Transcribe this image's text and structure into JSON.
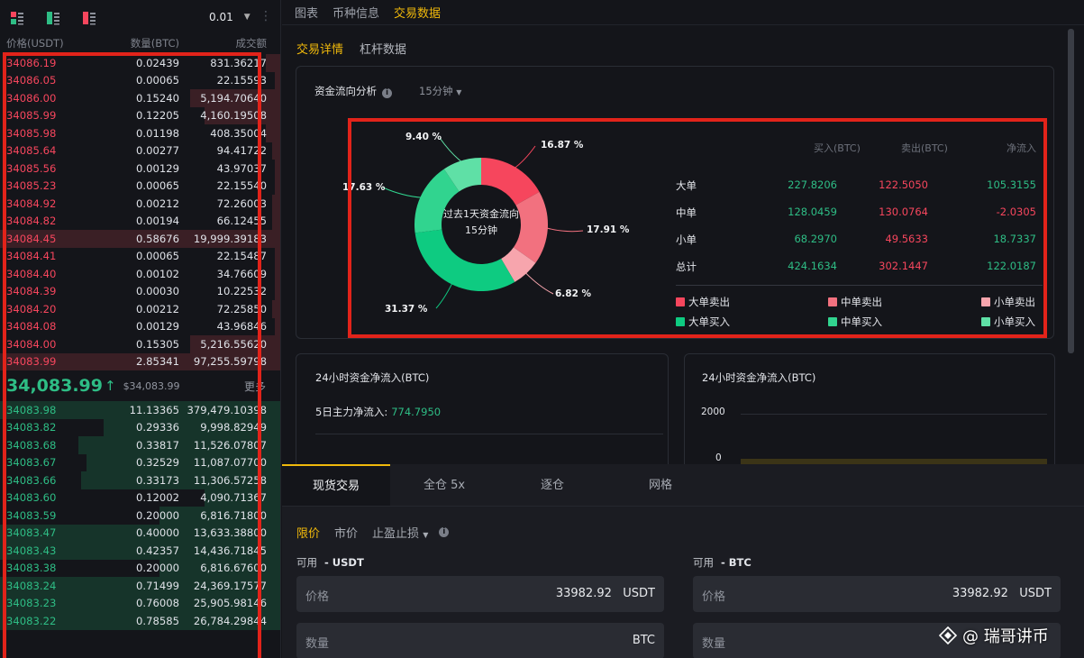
{
  "orderbook": {
    "precision": "0.01",
    "headers": {
      "price": "价格(USDT)",
      "amount": "数量(BTC)",
      "total": "成交额"
    },
    "asks": [
      {
        "price": "34086.19",
        "amount": "0.02439",
        "total": "831.36217",
        "depth": 0.05
      },
      {
        "price": "34086.05",
        "amount": "0.00065",
        "total": "22.15593",
        "depth": 0.02
      },
      {
        "price": "34086.00",
        "amount": "0.15240",
        "total": "5,194.70640",
        "depth": 0.32
      },
      {
        "price": "34085.99",
        "amount": "0.12205",
        "total": "4,160.19508",
        "depth": 0.27
      },
      {
        "price": "34085.98",
        "amount": "0.01198",
        "total": "408.35004",
        "depth": 0.05
      },
      {
        "price": "34085.64",
        "amount": "0.00277",
        "total": "94.41722",
        "depth": 0.03
      },
      {
        "price": "34085.56",
        "amount": "0.00129",
        "total": "43.97037",
        "depth": 0.02
      },
      {
        "price": "34085.23",
        "amount": "0.00065",
        "total": "22.15540",
        "depth": 0.02
      },
      {
        "price": "34084.92",
        "amount": "0.00212",
        "total": "72.26003",
        "depth": 0.03
      },
      {
        "price": "34084.82",
        "amount": "0.00194",
        "total": "66.12455",
        "depth": 0.03
      },
      {
        "price": "34084.45",
        "amount": "0.58676",
        "total": "19,999.39183",
        "depth": 1.0
      },
      {
        "price": "34084.41",
        "amount": "0.00065",
        "total": "22.15487",
        "depth": 0.02
      },
      {
        "price": "34084.40",
        "amount": "0.00102",
        "total": "34.76609",
        "depth": 0.02
      },
      {
        "price": "34084.39",
        "amount": "0.00030",
        "total": "10.22532",
        "depth": 0.02
      },
      {
        "price": "34084.20",
        "amount": "0.00212",
        "total": "72.25850",
        "depth": 0.03
      },
      {
        "price": "34084.08",
        "amount": "0.00129",
        "total": "43.96846",
        "depth": 0.02
      },
      {
        "price": "34084.00",
        "amount": "0.15305",
        "total": "5,216.55620",
        "depth": 0.32
      },
      {
        "price": "34083.99",
        "amount": "2.85341",
        "total": "97,255.59798",
        "depth": 1.0
      }
    ],
    "mid": {
      "price": "34,083.99",
      "arrow": "↑",
      "usd": "$34,083.99",
      "more": "更多"
    },
    "bids": [
      {
        "price": "34083.98",
        "amount": "11.13365",
        "total": "379,479.10398",
        "depth": 1.0
      },
      {
        "price": "34083.82",
        "amount": "0.29336",
        "total": "9,998.82949",
        "depth": 0.63
      },
      {
        "price": "34083.68",
        "amount": "0.33817",
        "total": "11,526.07807",
        "depth": 0.72
      },
      {
        "price": "34083.67",
        "amount": "0.32529",
        "total": "11,087.07700",
        "depth": 0.69
      },
      {
        "price": "34083.66",
        "amount": "0.33173",
        "total": "11,306.57258",
        "depth": 0.71
      },
      {
        "price": "34083.60",
        "amount": "0.12002",
        "total": "4,090.71367",
        "depth": 0.27
      },
      {
        "price": "34083.59",
        "amount": "0.20000",
        "total": "6,816.71800",
        "depth": 0.43
      },
      {
        "price": "34083.47",
        "amount": "0.40000",
        "total": "13,633.38800",
        "depth": 1.0
      },
      {
        "price": "34083.43",
        "amount": "0.42357",
        "total": "14,436.71845",
        "depth": 1.0
      },
      {
        "price": "34083.38",
        "amount": "0.20000",
        "total": "6,816.67600",
        "depth": 0.43
      },
      {
        "price": "34083.24",
        "amount": "0.71499",
        "total": "24,369.17577",
        "depth": 1.0
      },
      {
        "price": "34083.23",
        "amount": "0.76008",
        "total": "25,905.98146",
        "depth": 1.0
      },
      {
        "price": "34083.22",
        "amount": "0.78585",
        "total": "26,784.29844",
        "depth": 1.0
      }
    ]
  },
  "top_tabs": [
    "图表",
    "币种信息",
    "交易数据"
  ],
  "sub_tabs": [
    "交易详情",
    "杠杆数据"
  ],
  "flow": {
    "title": "资金流向分析",
    "interval": "15分钟",
    "center_line1": "过去1天资金流向",
    "center_line2": "15分钟",
    "slices": [
      {
        "label": "16.87 %",
        "value": 16.87,
        "color": "#f6465d"
      },
      {
        "label": "17.91 %",
        "value": 17.91,
        "color": "#f2717f"
      },
      {
        "label": "6.82 %",
        "value": 6.82,
        "color": "#f7a5ad"
      },
      {
        "label": "31.37 %",
        "value": 31.37,
        "color": "#0ecb81"
      },
      {
        "label": "17.63 %",
        "value": 17.63,
        "color": "#31d48f"
      },
      {
        "label": "9.40 %",
        "value": 9.4,
        "color": "#5fe0a6"
      }
    ],
    "table": {
      "headers": [
        "买入(BTC)",
        "卖出(BTC)",
        "净流入"
      ],
      "rows": [
        {
          "label": "大单",
          "buy": "227.8206",
          "sell": "122.5050",
          "net": "105.3155",
          "net_color": "g"
        },
        {
          "label": "中单",
          "buy": "128.0459",
          "sell": "130.0764",
          "net": "-2.0305",
          "net_color": "r"
        },
        {
          "label": "小单",
          "buy": "68.2970",
          "sell": "49.5633",
          "net": "18.7337",
          "net_color": "g"
        },
        {
          "label": "总计",
          "buy": "424.1634",
          "sell": "302.1447",
          "net": "122.0187",
          "net_color": "g"
        }
      ]
    },
    "legend": [
      {
        "label": "大单卖出",
        "color": "#f6465d"
      },
      {
        "label": "中单卖出",
        "color": "#f2717f"
      },
      {
        "label": "小单卖出",
        "color": "#f7a5ad"
      },
      {
        "label": "大单买入",
        "color": "#0ecb81"
      },
      {
        "label": "中单买入",
        "color": "#31d48f"
      },
      {
        "label": "小单买入",
        "color": "#5fe0a6"
      }
    ]
  },
  "inflow": {
    "title": "24小时资金净流入(BTC)",
    "five_day_label": "5日主力净流入:",
    "five_day_value": "774.7950"
  },
  "chart_card": {
    "title": "24小时资金净流入(BTC)",
    "y_labels": [
      "2000",
      "0"
    ]
  },
  "trade": {
    "tabs": [
      "现货交易",
      "全仓 5x",
      "逐仓",
      "网格"
    ],
    "order_types": [
      "限价",
      "市价",
      "止盈止损"
    ],
    "left": {
      "avail_label": "可用",
      "avail_value": "- USDT",
      "price_ph": "价格",
      "price_val": "33982.92",
      "price_unit": "USDT",
      "qty_ph": "数量",
      "qty_unit": "BTC"
    },
    "right": {
      "avail_label": "可用",
      "avail_value": "- BTC",
      "price_ph": "价格",
      "price_val": "33982.92",
      "price_unit": "USDT",
      "qty_ph": "数量"
    }
  },
  "watermark": "@ 瑞哥讲币"
}
